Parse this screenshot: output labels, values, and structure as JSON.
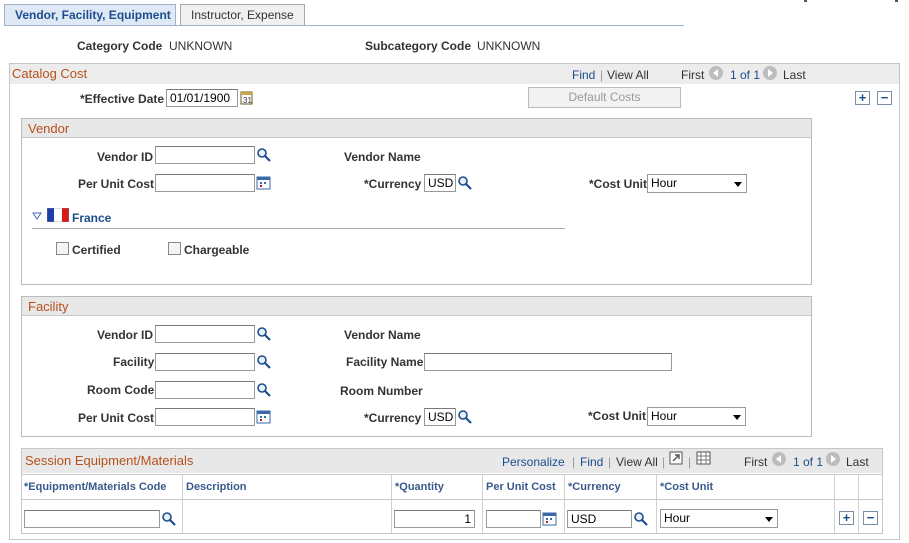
{
  "tabs": [
    {
      "label": "Vendor, Facility, Equipment",
      "active": true
    },
    {
      "label": "Instructor, Expense",
      "active": false
    }
  ],
  "header": {
    "category_code_label": "Category Code",
    "category_code_value": "UNKNOWN",
    "subcategory_code_label": "Subcategory Code",
    "subcategory_code_value": "UNKNOWN"
  },
  "catalog_cost": {
    "title": "Catalog Cost",
    "nav": {
      "find": "Find",
      "view_all": "View All",
      "first": "First",
      "count": "1 of 1",
      "last": "Last"
    },
    "effective_date_label": "*Effective Date",
    "effective_date_value": "01/01/1900",
    "default_costs_button": "Default Costs"
  },
  "vendor": {
    "title": "Vendor",
    "vendor_id_label": "Vendor ID",
    "vendor_id_value": "",
    "vendor_name_label": "Vendor Name",
    "per_unit_cost_label": "Per Unit Cost",
    "per_unit_cost_value": "",
    "currency_label": "*Currency",
    "currency_value": "USD",
    "cost_unit_label": "*Cost Unit",
    "cost_unit_value": "Hour",
    "country_label": "France",
    "certified_label": "Certified",
    "chargeable_label": "Chargeable"
  },
  "facility": {
    "title": "Facility",
    "vendor_id_label": "Vendor ID",
    "vendor_name_label": "Vendor Name",
    "facility_label": "Facility",
    "facility_name_label": "Facility Name",
    "room_code_label": "Room Code",
    "room_number_label": "Room Number",
    "per_unit_cost_label": "Per Unit Cost",
    "currency_label": "*Currency",
    "currency_value": "USD",
    "cost_unit_label": "*Cost Unit",
    "cost_unit_value": "Hour"
  },
  "equipment": {
    "title": "Session Equipment/Materials",
    "nav": {
      "personalize": "Personalize",
      "find": "Find",
      "view_all": "View All",
      "first": "First",
      "count": "1 of 1",
      "last": "Last"
    },
    "columns": [
      "*Equipment/Materials Code",
      "Description",
      "*Quantity",
      "Per Unit Cost",
      "*Currency",
      "*Cost Unit"
    ],
    "row": {
      "code": "",
      "description": "",
      "quantity": "1",
      "per_unit_cost": "",
      "currency": "USD",
      "cost_unit": "Hour"
    }
  },
  "colors": {
    "link": "#1c4d8c",
    "section_title": "#b5511c",
    "tab_active_bg": "#dfe8f5"
  }
}
